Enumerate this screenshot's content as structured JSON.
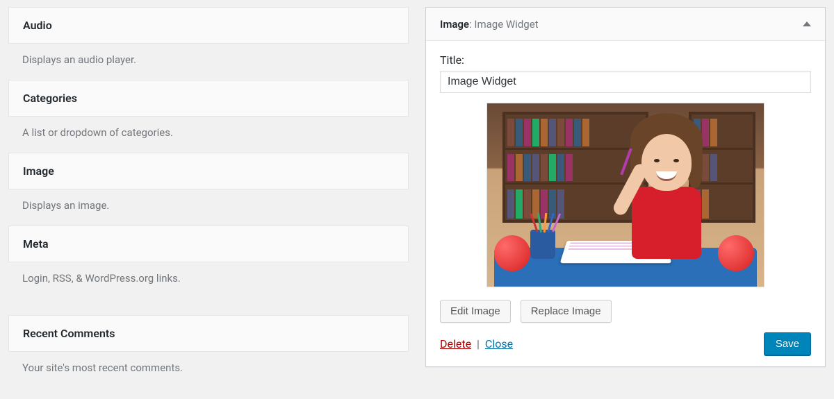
{
  "available_widgets": [
    {
      "title": "Audio",
      "description": "Displays an audio player."
    },
    {
      "title": "Categories",
      "description": "A list or dropdown of categories."
    },
    {
      "title": "Image",
      "description": "Displays an image."
    },
    {
      "title": "Meta",
      "description": "Login, RSS, & WordPress.org links."
    },
    {
      "title": "Recent Comments",
      "description": "Your site's most recent comments."
    }
  ],
  "widget_editor": {
    "header_label": "Image",
    "header_separator": ": ",
    "header_subtitle": "Image Widget",
    "title_field_label": "Title:",
    "title_value": "Image Widget",
    "edit_image_label": "Edit Image",
    "replace_image_label": "Replace Image",
    "delete_label": "Delete",
    "link_separator": " | ",
    "close_label": "Close",
    "save_label": "Save"
  }
}
